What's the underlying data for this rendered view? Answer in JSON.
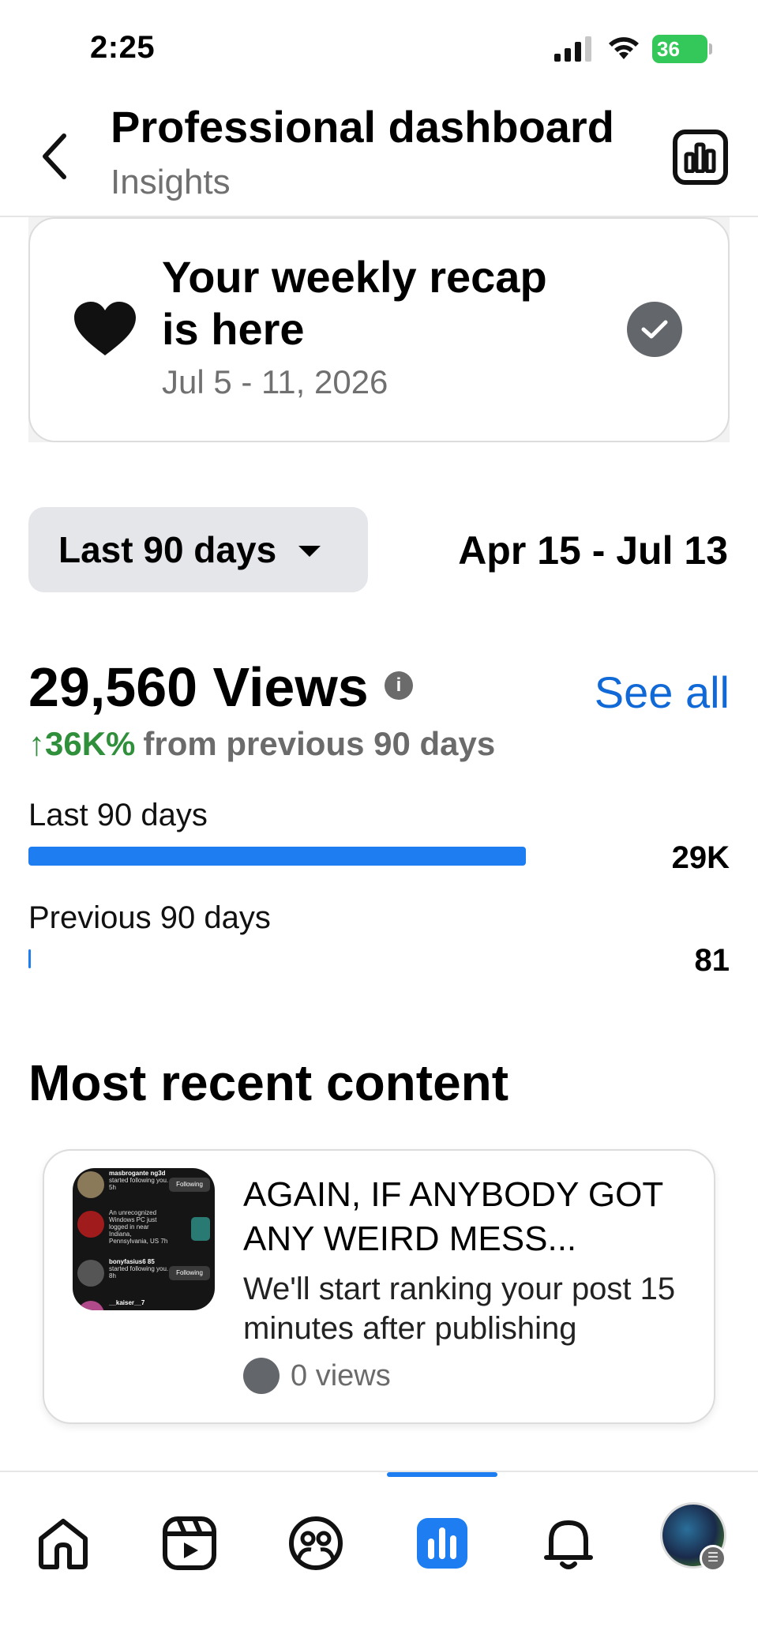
{
  "status_bar": {
    "time": "2:25",
    "battery": "36"
  },
  "header": {
    "title": "Professional dashboard",
    "subtitle": "Insights"
  },
  "recap": {
    "title": "Your weekly recap is here",
    "dates": "Jul 5 - 11, 2026"
  },
  "range": {
    "selected": "Last 90 days",
    "dates": "Apr 15 - Jul 13"
  },
  "views": {
    "title": "29,560 Views",
    "info_glyph": "i",
    "see_all": "See all",
    "change_pct": "↑36K%",
    "change_text": "from previous 90 days",
    "bars": [
      {
        "label": "Last 90 days",
        "value": "29K",
        "fraction": 0.985
      },
      {
        "label": "Previous 90 days",
        "value": "81",
        "fraction": 0.003
      }
    ]
  },
  "recent": {
    "section_title": "Most recent content",
    "item": {
      "title": "AGAIN, IF ANYBODY GOT ANY WEIRD MESS...",
      "description": "We'll start ranking your post 15 minutes after publishing",
      "views": "0 views",
      "thumbnail": {
        "rows": [
          {
            "name": "masbrogante ng3d",
            "text": "started following you.",
            "time": "5h",
            "action": "Following"
          },
          {
            "name": "",
            "text": "An unrecognized Windows PC just logged in near Indiana, Pennsylvania, US",
            "time": "7h",
            "action": ""
          },
          {
            "name": "bonyfasius6 85",
            "text": "started following you.",
            "time": "8h",
            "action": "Following"
          },
          {
            "name": "__kaiser__7",
            "text": "",
            "time": "",
            "action": ""
          }
        ]
      }
    }
  },
  "nav": {
    "items": [
      "home-icon",
      "reels-icon",
      "friends-icon",
      "dashboard-icon",
      "bell-icon",
      "profile-avatar"
    ],
    "active_index": 3,
    "accent": "#1e7df0"
  }
}
